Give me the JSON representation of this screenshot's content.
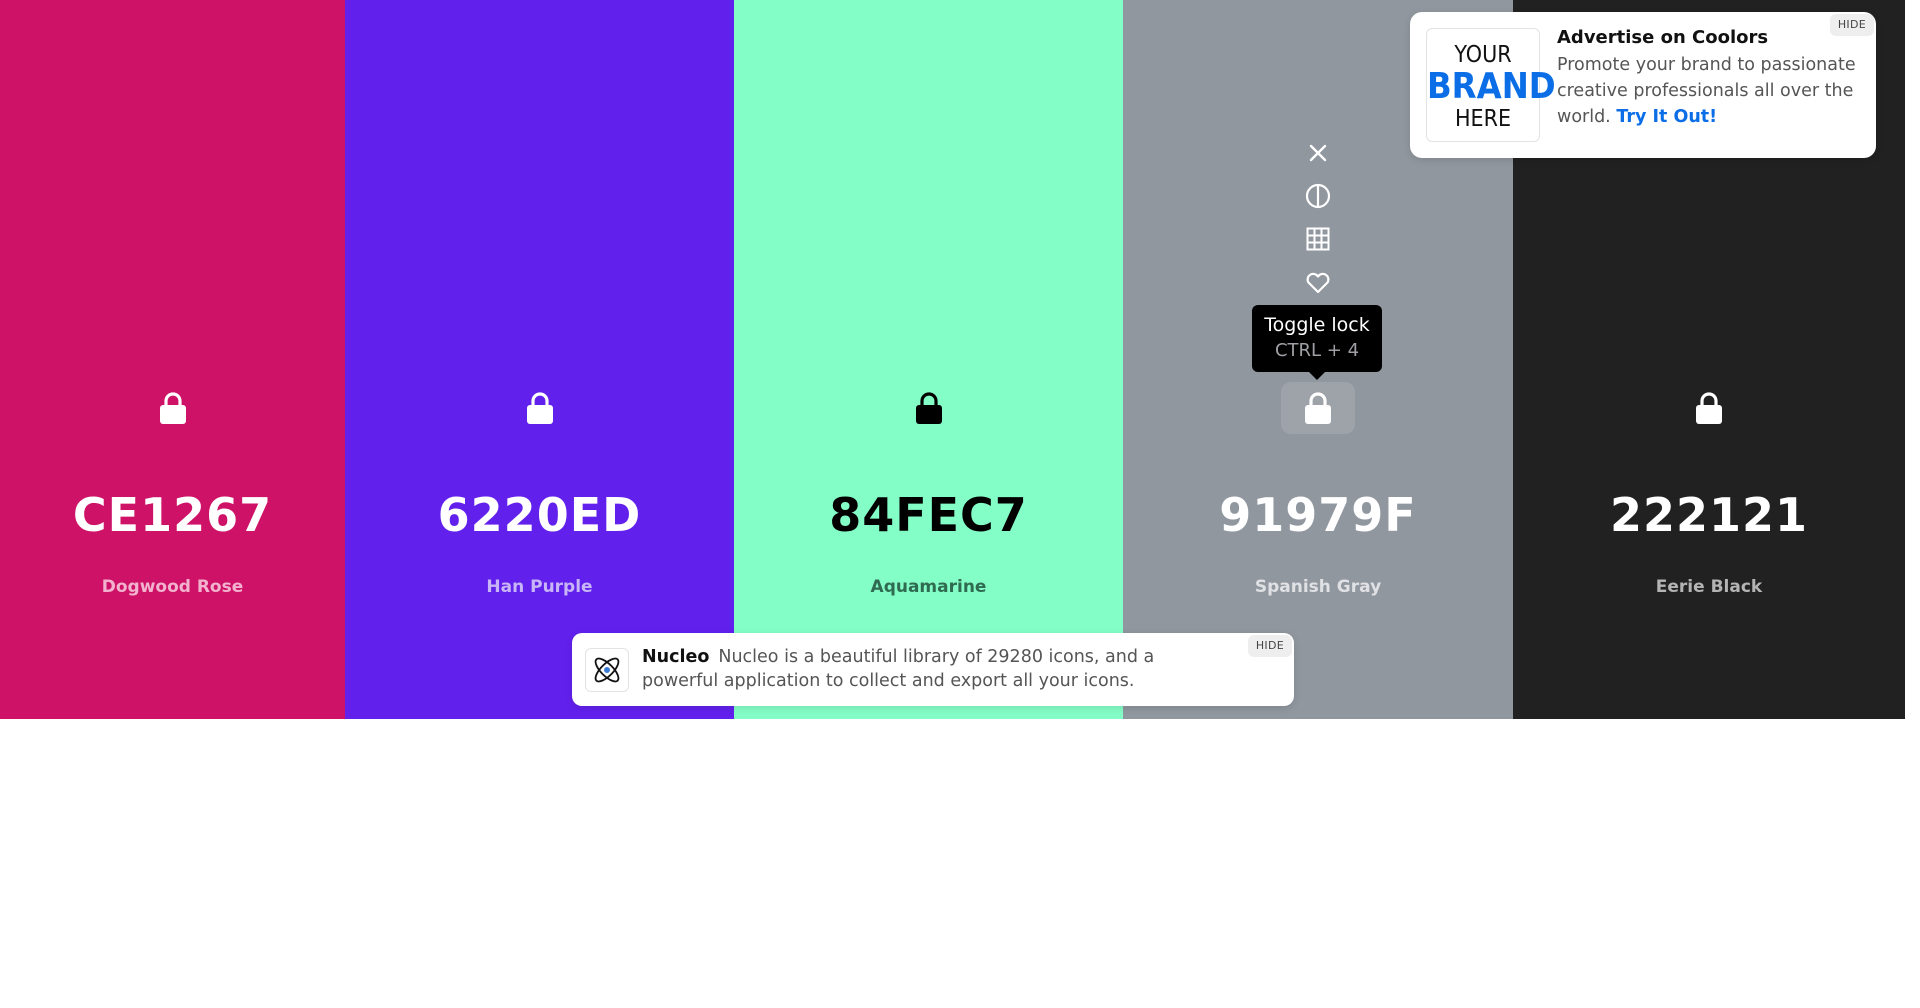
{
  "palette": [
    {
      "hex": "CE1267",
      "name": "Dogwood Rose",
      "color": "#CE1267",
      "text_color": "#ffffff",
      "name_color": "#f2b3cf",
      "lock_icon": "lock-icon",
      "locked": false
    },
    {
      "hex": "6220ED",
      "name": "Han Purple",
      "color": "#6220ED",
      "text_color": "#ffffff",
      "name_color": "#c7b5f7",
      "lock_icon": "lock-icon",
      "locked": false
    },
    {
      "hex": "84FEC7",
      "name": "Aquamarine",
      "color": "#84FEC7",
      "text_color": "#000000",
      "name_color": "#2f6b50",
      "lock_icon": "lock-icon",
      "locked": false
    },
    {
      "hex": "91979F",
      "name": "Spanish Gray",
      "color": "#91979F",
      "text_color": "#ffffff",
      "name_color": "#dfe1e4",
      "lock_icon": "lock-icon",
      "locked": false
    },
    {
      "hex": "222121",
      "name": "Eerie Black",
      "color": "#222121",
      "text_color": "#ffffff",
      "name_color": "#b4b4b4",
      "lock_icon": "lock-icon",
      "locked": false
    }
  ],
  "hovered_swatch_tools": [
    "close-icon",
    "contrast-icon",
    "shades-grid-icon",
    "heart-icon",
    "drag-icon",
    "lock-icon"
  ],
  "tooltip": {
    "title": "Toggle lock",
    "shortcut": "CTRL + 4"
  },
  "ad": {
    "logo": {
      "line1": "YOUR",
      "line2": "BRAND",
      "line3": "HERE"
    },
    "title": "Advertise on Coolors",
    "body": "Promote your brand to passionate creative professionals all over the world.",
    "link": "Try It Out!",
    "hide_label": "HIDE"
  },
  "nucleo": {
    "title": "Nucleo",
    "body": "Nucleo is a beautiful library of 29280 icons, and a powerful application to collect and export all your icons.",
    "hide_label": "HIDE",
    "icon": "atom-icon"
  },
  "colors": {
    "link": "#0b6ee6",
    "tooltip_bg": "#000000"
  }
}
